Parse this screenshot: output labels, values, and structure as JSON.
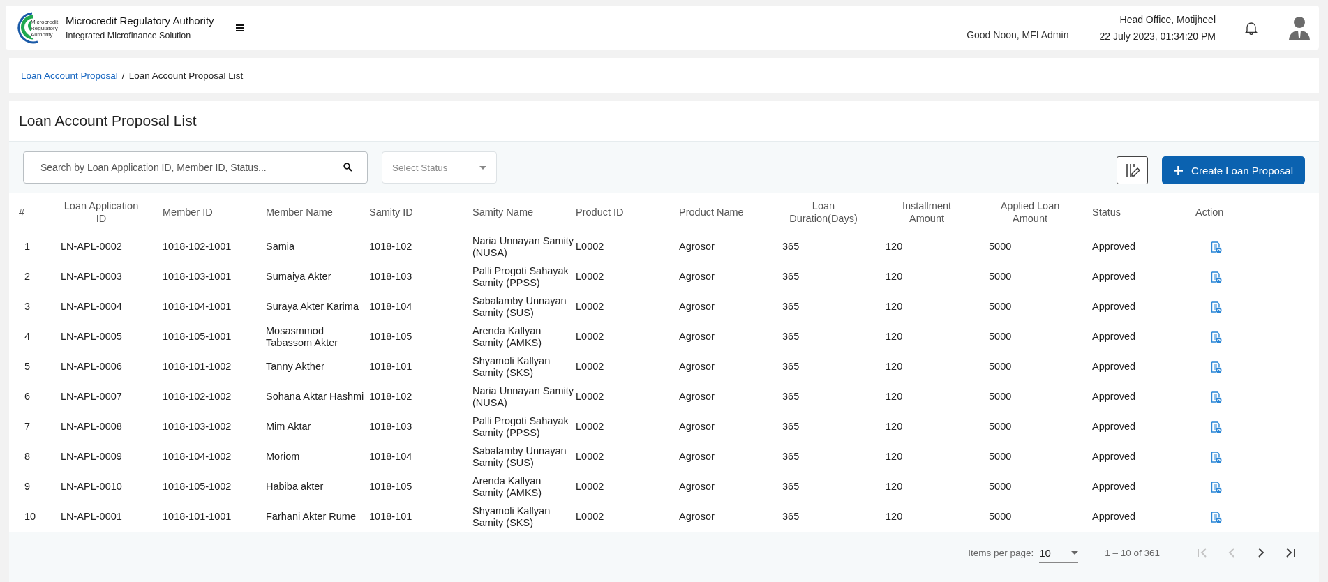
{
  "header": {
    "org_name": "Microcredit Regulatory Authority",
    "org_subtitle": "Integrated Microfinance Solution",
    "logo_text": [
      "Microcredit",
      "Regulatory",
      "Authority"
    ],
    "greeting": "Good Noon, MFI Admin",
    "office": "Head Office, Motijheel",
    "datetime": "22 July 2023, 01:34:20 PM"
  },
  "breadcrumb": {
    "link": "Loan Account Proposal",
    "separator": "/",
    "current": "Loan Account Proposal List"
  },
  "page_title": "Loan Account Proposal List",
  "search": {
    "placeholder": "Search by Loan Application ID, Member ID, Status..."
  },
  "status_select": {
    "placeholder": "Select Status"
  },
  "create_button": "Create Loan Proposal",
  "table": {
    "columns": [
      "#",
      "Loan Application ID",
      "Member ID",
      "Member Name",
      "Samity ID",
      "Samity Name",
      "Product ID",
      "Product Name",
      "Loan Duration(Days)",
      "Installment Amount",
      "Applied Loan Amount",
      "Status",
      "Action"
    ],
    "rows": [
      [
        "1",
        "LN-APL-0002",
        "1018-102-1001",
        "Samia",
        "1018-102",
        "Naria Unnayan Samity (NUSA)",
        "L0002",
        "Agrosor",
        "365",
        "120",
        "5000",
        "Approved"
      ],
      [
        "2",
        "LN-APL-0003",
        "1018-103-1001",
        "Sumaiya Akter",
        "1018-103",
        "Palli Progoti Sahayak Samity (PPSS)",
        "L0002",
        "Agrosor",
        "365",
        "120",
        "5000",
        "Approved"
      ],
      [
        "3",
        "LN-APL-0004",
        "1018-104-1001",
        "Suraya Akter Karima",
        "1018-104",
        "Sabalamby Unnayan Samity (SUS)",
        "L0002",
        "Agrosor",
        "365",
        "120",
        "5000",
        "Approved"
      ],
      [
        "4",
        "LN-APL-0005",
        "1018-105-1001",
        "Mosasmmod Tabassom Akter",
        "1018-105",
        "Arenda Kallyan Samity (AMKS)",
        "L0002",
        "Agrosor",
        "365",
        "120",
        "5000",
        "Approved"
      ],
      [
        "5",
        "LN-APL-0006",
        "1018-101-1002",
        "Tanny Akther",
        "1018-101",
        "Shyamoli Kallyan Samity (SKS)",
        "L0002",
        "Agrosor",
        "365",
        "120",
        "5000",
        "Approved"
      ],
      [
        "6",
        "LN-APL-0007",
        "1018-102-1002",
        "Sohana Aktar Hashmi",
        "1018-102",
        "Naria Unnayan Samity (NUSA)",
        "L0002",
        "Agrosor",
        "365",
        "120",
        "5000",
        "Approved"
      ],
      [
        "7",
        "LN-APL-0008",
        "1018-103-1002",
        "Mim Aktar",
        "1018-103",
        "Palli Progoti Sahayak Samity (PPSS)",
        "L0002",
        "Agrosor",
        "365",
        "120",
        "5000",
        "Approved"
      ],
      [
        "8",
        "LN-APL-0009",
        "1018-104-1002",
        "Moriom",
        "1018-104",
        "Sabalamby Unnayan Samity (SUS)",
        "L0002",
        "Agrosor",
        "365",
        "120",
        "5000",
        "Approved"
      ],
      [
        "9",
        "LN-APL-0010",
        "1018-105-1002",
        "Habiba akter",
        "1018-105",
        "Arenda Kallyan Samity (AMKS)",
        "L0002",
        "Agrosor",
        "365",
        "120",
        "5000",
        "Approved"
      ],
      [
        "10",
        "LN-APL-0001",
        "1018-101-1001",
        "Farhani Akter Rume",
        "1018-101",
        "Shyamoli Kallyan Samity (SKS)",
        "L0002",
        "Agrosor",
        "365",
        "120",
        "5000",
        "Approved"
      ]
    ]
  },
  "pagination": {
    "items_per_page_label": "Items per page:",
    "page_size": "10",
    "range": "1 – 10 of 361",
    "buttons": [
      {
        "kind": "first",
        "disabled": true
      },
      {
        "kind": "prev",
        "disabled": true
      },
      {
        "kind": "next",
        "disabled": false
      },
      {
        "kind": "last",
        "disabled": false
      }
    ]
  }
}
